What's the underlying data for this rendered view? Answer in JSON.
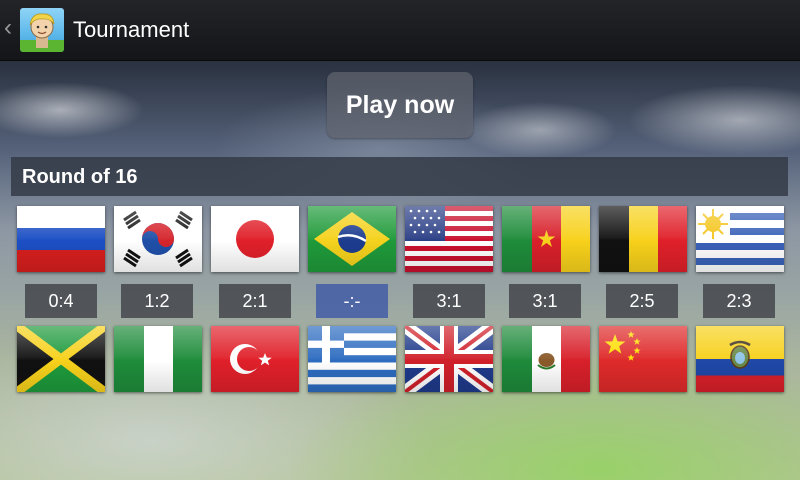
{
  "action_bar": {
    "title": "Tournament",
    "app_icon": "boy-avatar-icon",
    "back_icon": "chevron-left-icon"
  },
  "play_button": {
    "label": "Play now"
  },
  "round": {
    "title": "Round of 16",
    "matches": [
      {
        "home": "Russia",
        "away": "Jamaica",
        "score": "0:4",
        "pending": false
      },
      {
        "home": "South Korea",
        "away": "Nigeria",
        "score": "1:2",
        "pending": false
      },
      {
        "home": "Japan",
        "away": "Turkey",
        "score": "2:1",
        "pending": false
      },
      {
        "home": "Brazil",
        "away": "Greece",
        "score": "-:-",
        "pending": true
      },
      {
        "home": "United States",
        "away": "United Kingdom",
        "score": "3:1",
        "pending": false
      },
      {
        "home": "Cameroon",
        "away": "Mexico",
        "score": "3:1",
        "pending": false
      },
      {
        "home": "Belgium",
        "away": "China",
        "score": "2:5",
        "pending": false
      },
      {
        "home": "Uruguay",
        "away": "Ecuador",
        "score": "2:3",
        "pending": false
      }
    ]
  },
  "colors": {
    "score_pending_bg": "#465fa5",
    "score_bg": "#3c3e44",
    "action_bar_bg": "#1a1b1e"
  }
}
